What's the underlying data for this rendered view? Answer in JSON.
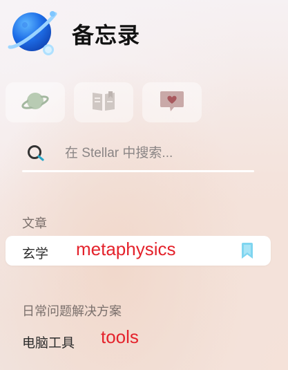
{
  "header": {
    "title": "备忘录",
    "logo_icon": "planet-logo-icon"
  },
  "tabs": [
    {
      "icon": "planet-icon",
      "color": "#a9bfa6"
    },
    {
      "icon": "book-icon",
      "color": "#c8c0bc"
    },
    {
      "icon": "heart-chat-icon",
      "color": "#b67f80"
    }
  ],
  "search": {
    "placeholder": "在 Stellar 中搜索...",
    "value": ""
  },
  "sections": [
    {
      "title": "文章",
      "items": [
        {
          "label": "玄学",
          "annotation": "metaphysics",
          "active": true,
          "icon": "bookmark-icon"
        }
      ]
    },
    {
      "title": "日常问题解决方案",
      "items": [
        {
          "label": "电脑工具",
          "annotation": "tools",
          "active": false
        }
      ]
    }
  ],
  "colors": {
    "annotation": "#e4222b",
    "bookmark": "#7fd5f0",
    "active_bg": "#ffffff"
  }
}
